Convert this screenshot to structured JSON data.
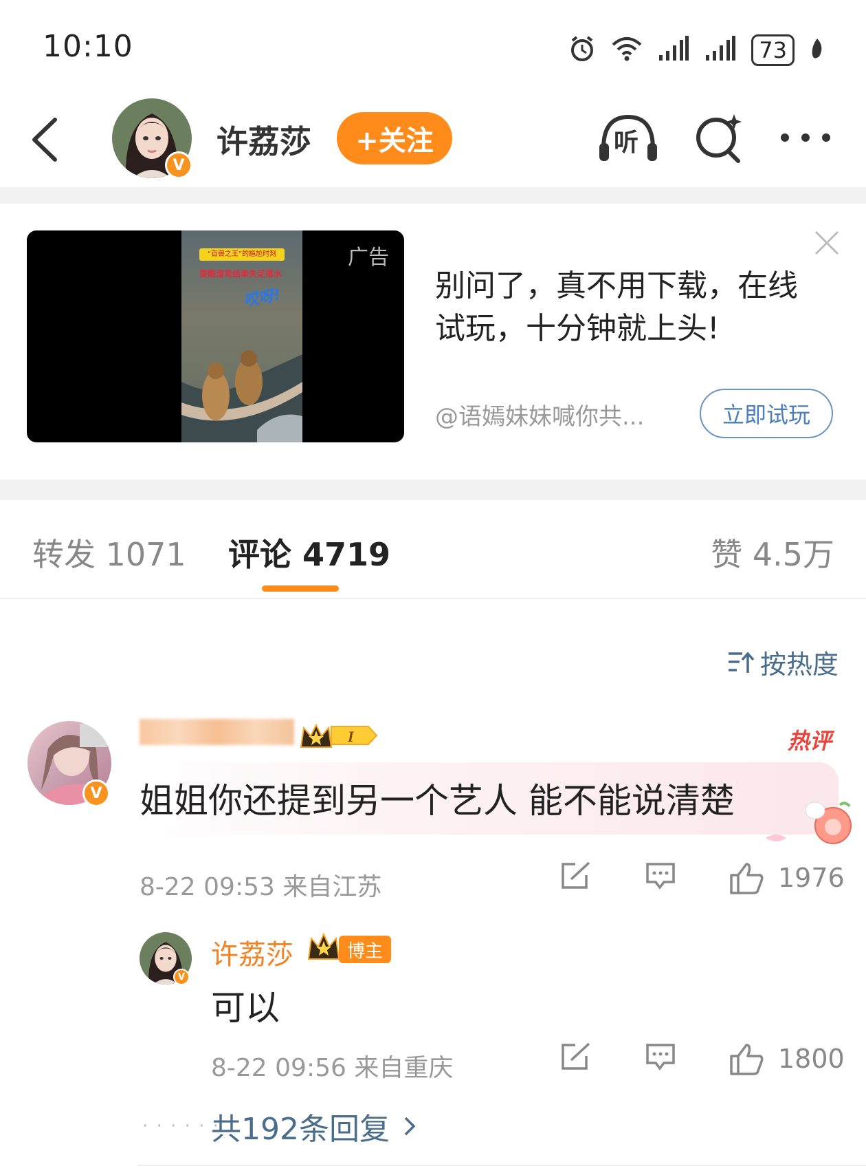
{
  "status_bar": {
    "time": "10:10",
    "battery": "73"
  },
  "header": {
    "username": "许荔莎",
    "follow_label": "+关注",
    "listen_label": "听"
  },
  "ad": {
    "tag": "广告",
    "video_caption_top": "“百兽之王”的尴尬时刻",
    "video_caption_2": "耍酷溜弯结果失足落水",
    "video_caption_3": "哎呀!",
    "text": "别问了，真不用下载，在线试玩，十分钟就上头!",
    "source": "@语嫣妹妹喊你共...",
    "cta_label": "立即试玩"
  },
  "tabs": {
    "repost": "转发 1071",
    "comment": "评论 4719",
    "like": "赞 4.5万"
  },
  "sort_label": "按热度",
  "comment": {
    "hot_tag": "热评",
    "text": "姐姐你还提到另一个艺人 能不能说清楚",
    "meta": "8-22 09:53 来自江苏",
    "likes": "1976"
  },
  "reply": {
    "name": "许荔莎",
    "badge": "博主",
    "text": "可以",
    "meta": "8-22 09:56 来自重庆",
    "likes": "1800"
  },
  "more_replies": "共192条回复",
  "colors": {
    "accent": "#ff8c1a",
    "link": "#4a6d8c",
    "hot": "#e8453c"
  }
}
